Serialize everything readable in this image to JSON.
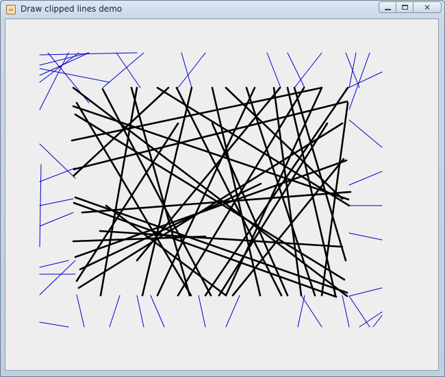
{
  "window": {
    "title": "Draw clipped lines demo"
  },
  "icons": {
    "app": "java-cup-icon",
    "minimize": "minimize-icon",
    "maximize": "maximize-icon",
    "close": "close-icon"
  },
  "colors": {
    "clipped": "#0000cc",
    "visible": "#000000",
    "background": "#eeeeee"
  },
  "demo": {
    "description": "clipped line drawing",
    "inner_lines": [
      [
        107,
        128,
        507,
        432
      ],
      [
        110,
        167,
        503,
        408
      ],
      [
        107,
        155,
        509,
        291
      ],
      [
        112,
        150,
        279,
        431
      ],
      [
        280,
        128,
        208,
        431
      ],
      [
        192,
        128,
        277,
        431
      ],
      [
        200,
        128,
        147,
        431
      ],
      [
        108,
        247,
        507,
        148
      ],
      [
        110,
        288,
        507,
        427
      ],
      [
        108,
        296,
        491,
        433
      ],
      [
        120,
        310,
        512,
        280
      ],
      [
        110,
        375,
        506,
        234
      ],
      [
        107,
        352,
        300,
        345
      ],
      [
        117,
        393,
        381,
        268
      ],
      [
        155,
        300,
        330,
        431
      ],
      [
        146,
        337,
        500,
        360
      ],
      [
        200,
        380,
        409,
        128
      ],
      [
        230,
        431,
        372,
        128
      ],
      [
        260,
        431,
        444,
        128
      ],
      [
        300,
        431,
        508,
        128
      ],
      [
        320,
        431,
        478,
        180
      ],
      [
        340,
        431,
        502,
        232
      ],
      [
        360,
        128,
        460,
        431
      ],
      [
        400,
        128,
        440,
        431
      ],
      [
        430,
        128,
        505,
        380
      ],
      [
        470,
        128,
        330,
        431
      ],
      [
        380,
        431,
        310,
        128
      ],
      [
        411,
        431,
        258,
        128
      ],
      [
        105,
        205,
        470,
        128
      ],
      [
        490,
        431,
        420,
        128
      ],
      [
        112,
        410,
        260,
        180
      ],
      [
        150,
        130,
        308,
        431
      ],
      [
        230,
        128,
        510,
        300
      ],
      [
        500,
        180,
        115,
        420
      ],
      [
        420,
        431,
        310,
        180
      ],
      [
        470,
        431,
        508,
        150
      ],
      [
        108,
        256,
        246,
        128
      ],
      [
        330,
        128,
        500,
        290
      ]
    ],
    "outer_lines": [
      [
        58,
        80,
        200,
        77
      ],
      [
        58,
        95,
        130,
        77
      ],
      [
        58,
        100,
        160,
        120
      ],
      [
        58,
        160,
        100,
        77
      ],
      [
        60,
        240,
        58,
        360
      ],
      [
        58,
        390,
        100,
        380
      ],
      [
        58,
        430,
        110,
        380
      ],
      [
        58,
        265,
        110,
        245
      ],
      [
        70,
        77,
        130,
        150
      ],
      [
        115,
        77,
        58,
        120
      ],
      [
        100,
        477,
        58,
        470
      ],
      [
        123,
        477,
        112,
        430
      ],
      [
        130,
        77,
        58,
        110
      ],
      [
        170,
        77,
        205,
        128
      ],
      [
        210,
        77,
        150,
        128
      ],
      [
        265,
        77,
        280,
        128
      ],
      [
        300,
        77,
        260,
        128
      ],
      [
        390,
        77,
        410,
        128
      ],
      [
        420,
        77,
        445,
        128
      ],
      [
        470,
        77,
        430,
        128
      ],
      [
        505,
        77,
        525,
        128
      ],
      [
        520,
        77,
        510,
        128
      ],
      [
        558,
        105,
        505,
        130
      ],
      [
        558,
        215,
        510,
        175
      ],
      [
        558,
        250,
        510,
        270
      ],
      [
        558,
        300,
        510,
        300
      ],
      [
        558,
        350,
        510,
        340
      ],
      [
        558,
        420,
        510,
        432
      ],
      [
        558,
        455,
        525,
        477
      ],
      [
        540,
        477,
        510,
        432
      ],
      [
        470,
        477,
        440,
        431
      ],
      [
        435,
        477,
        445,
        431
      ],
      [
        330,
        477,
        350,
        431
      ],
      [
        300,
        477,
        290,
        431
      ],
      [
        240,
        477,
        220,
        431
      ],
      [
        210,
        477,
        200,
        431
      ],
      [
        160,
        477,
        175,
        431
      ],
      [
        510,
        477,
        500,
        431
      ],
      [
        545,
        477,
        558,
        460
      ],
      [
        58,
        300,
        107,
        290
      ],
      [
        58,
        330,
        107,
        310
      ],
      [
        58,
        210,
        110,
        260
      ],
      [
        540,
        77,
        510,
        160
      ],
      [
        58,
        400,
        110,
        400
      ]
    ]
  }
}
